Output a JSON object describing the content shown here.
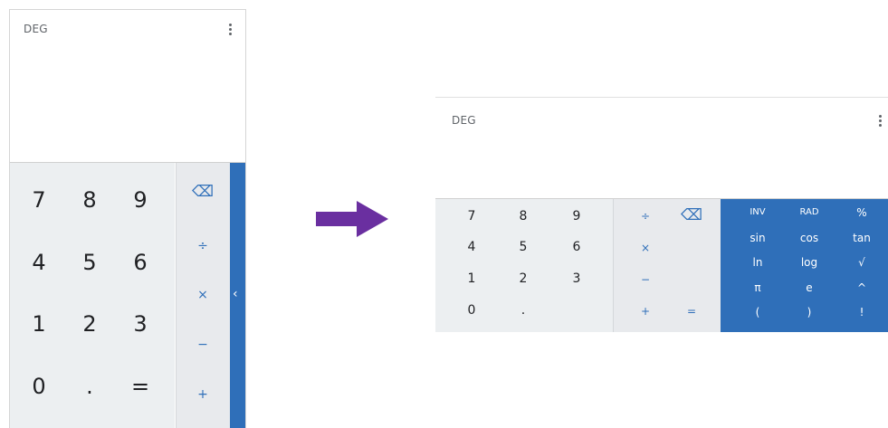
{
  "phone": {
    "mode": "DEG",
    "digits": [
      "7",
      "8",
      "9",
      "4",
      "5",
      "6",
      "1",
      "2",
      "3",
      "0",
      ".",
      "="
    ],
    "ops": {
      "backspace": "⌫",
      "divide": "÷",
      "multiply": "×",
      "minus": "−",
      "plus": "+"
    },
    "expand_icon": "‹"
  },
  "tablet": {
    "mode": "DEG",
    "digits": [
      "7",
      "8",
      "9",
      "4",
      "5",
      "6",
      "1",
      "2",
      "3",
      "0",
      "."
    ],
    "ops": {
      "divide": "÷",
      "backspace": "⌫",
      "multiply": "×",
      "minus": "−",
      "plus": "+",
      "equals": "="
    },
    "sci": [
      "INV",
      "RAD",
      "%",
      "sin",
      "cos",
      "tan",
      "ln",
      "log",
      "√",
      "π",
      "e",
      "^",
      "(",
      ")",
      "!"
    ]
  },
  "colors": {
    "accent": "#2f6fb9",
    "pad": "#eceff1",
    "arrow": "#6a2fa0"
  }
}
